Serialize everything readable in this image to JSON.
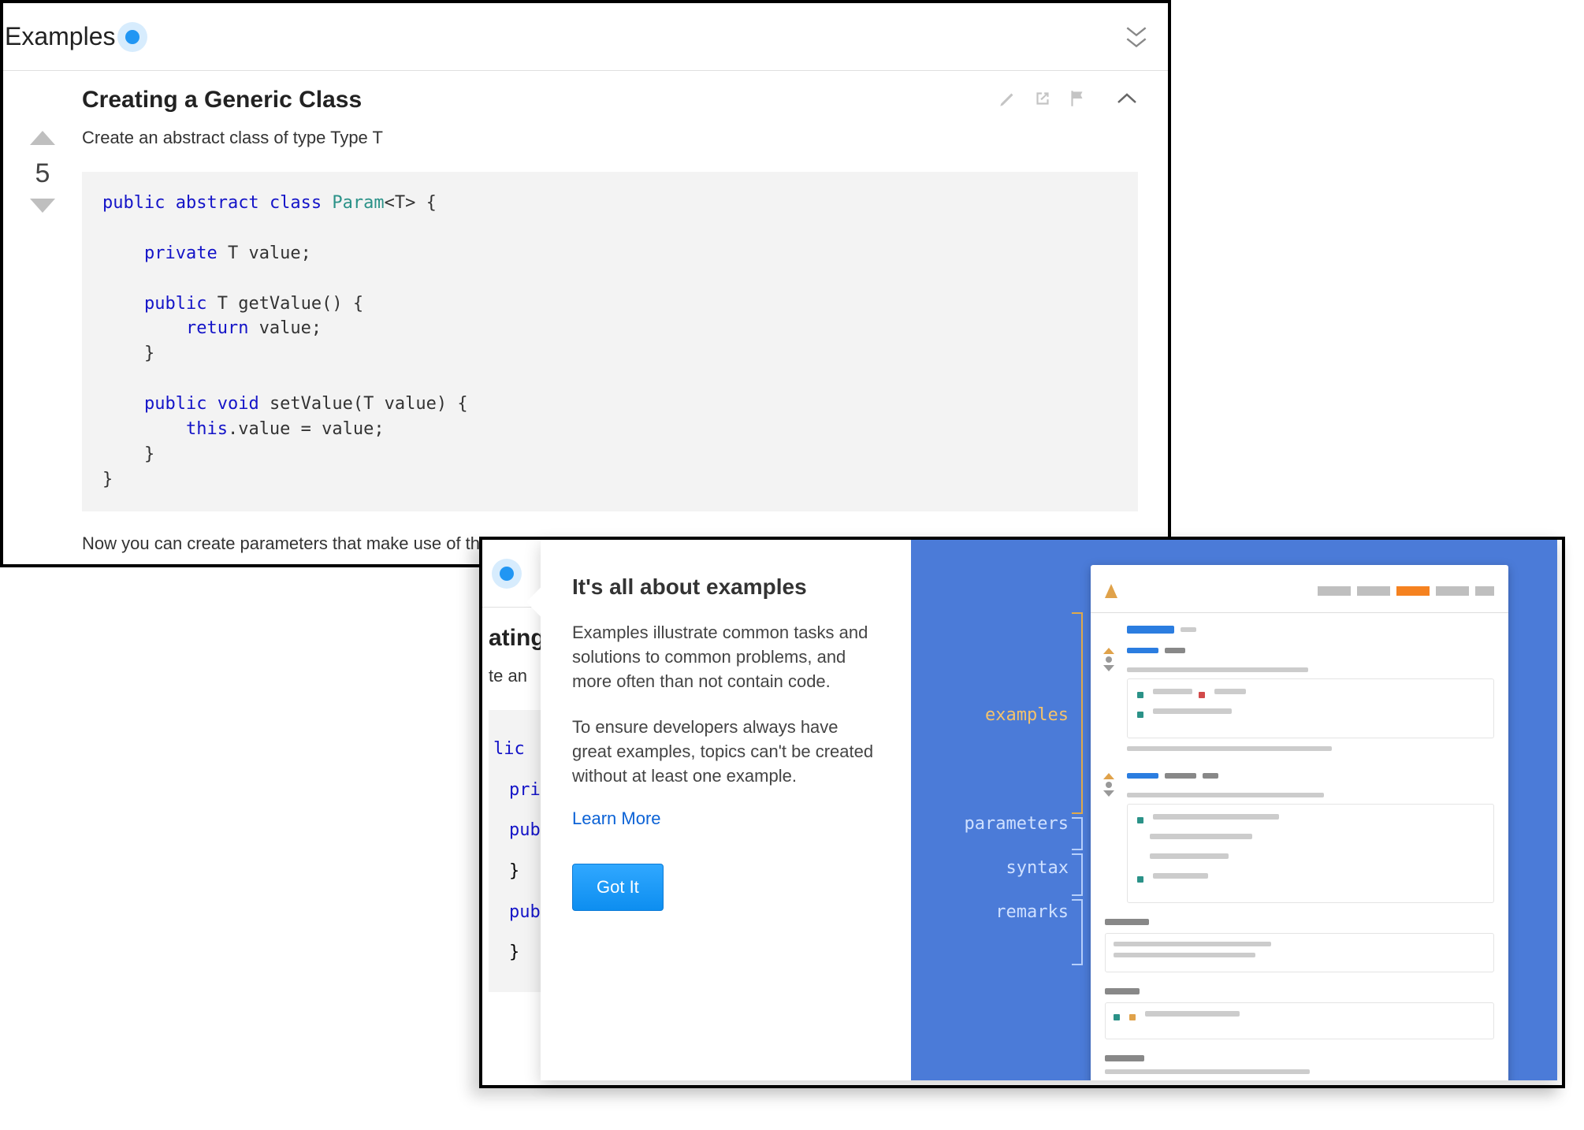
{
  "section": {
    "title": "Examples"
  },
  "example": {
    "title": "Creating a Generic Class",
    "desc": "Create an abstract class of type Type T",
    "vote_count": "5",
    "post_code_text": "Now you can create parameters that make use of the Generic class",
    "code_tokens": [
      {
        "t": "public ",
        "c": "kw"
      },
      {
        "t": "abstract ",
        "c": "kw"
      },
      {
        "t": "class ",
        "c": "kw"
      },
      {
        "t": "Param",
        "c": "ty"
      },
      {
        "t": "<T> {\n\n",
        "c": ""
      },
      {
        "t": "    ",
        "c": ""
      },
      {
        "t": "private ",
        "c": "kw"
      },
      {
        "t": "T value;\n\n",
        "c": ""
      },
      {
        "t": "    ",
        "c": ""
      },
      {
        "t": "public ",
        "c": "kw"
      },
      {
        "t": "T getValue() {\n",
        "c": ""
      },
      {
        "t": "        ",
        "c": ""
      },
      {
        "t": "return ",
        "c": "kw"
      },
      {
        "t": "value;\n    }\n\n",
        "c": ""
      },
      {
        "t": "    ",
        "c": ""
      },
      {
        "t": "public ",
        "c": "kw"
      },
      {
        "t": "void ",
        "c": "kw"
      },
      {
        "t": "setValue(T value) {\n",
        "c": ""
      },
      {
        "t": "        ",
        "c": ""
      },
      {
        "t": "this",
        "c": "kw"
      },
      {
        "t": ".value = value;\n    }\n}",
        "c": ""
      }
    ]
  },
  "front": {
    "title_fragment": "ating",
    "desc_fragment": "te an",
    "lines": [
      "lic",
      "pri",
      "pub",
      "}",
      "pub",
      "}"
    ]
  },
  "popup": {
    "title": "It's all about examples",
    "p1": "Examples illustrate common tasks and solutions to common problems, and more often than not contain code.",
    "p2": "To ensure developers always have great examples, topics can't be created without at least one example.",
    "learn_more": "Learn More",
    "got_it": "Got It",
    "labels": {
      "examples": "examples",
      "parameters": "parameters",
      "syntax": "syntax",
      "remarks": "remarks"
    }
  }
}
